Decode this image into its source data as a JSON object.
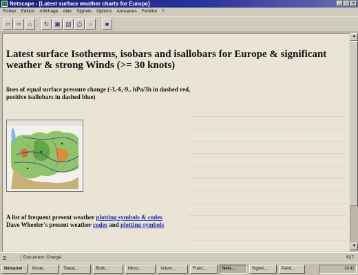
{
  "window": {
    "title": "Netscape - [Latest surface weather charts for Europe]"
  },
  "menu": {
    "items": [
      "Fichier",
      "Edition",
      "Affichage",
      "Aller",
      "Signets",
      "Options",
      "Annuaires",
      "Fenêtre",
      "?"
    ]
  },
  "toolbar": {
    "buttons": [
      {
        "icon": "back-arrow-icon"
      },
      {
        "icon": "forward-arrow-icon"
      },
      {
        "icon": "home-icon"
      },
      {
        "icon": "reload-icon"
      },
      {
        "icon": "images-icon"
      },
      {
        "icon": "open-icon"
      },
      {
        "icon": "print-icon"
      },
      {
        "icon": "find-icon"
      },
      {
        "icon": "stop-icon"
      }
    ]
  },
  "page": {
    "headline": "Latest surface Isotherms, isobars and isallobars for Europe & significant weather & strong Winds (>= 30 knots)",
    "subtitle_line1": "lines of equal surface pressure change (-3,-6,-9.. hPa/3h in dashed red,",
    "subtitle_line2": "positive isallobars in dashed blue)",
    "links_line1_prefix": "A list of frequent present weather ",
    "links_line1_link": "plotting symbols & codes",
    "links_line2_prefix": "Dave Wheeler's present weather ",
    "links_line2_link1": "codes",
    "links_line2_mid": " and ",
    "links_line2_link2": "plotting symbols"
  },
  "statusbar": {
    "text": "Document: Chargé",
    "right": "627"
  },
  "taskbar": {
    "start": "Démarrer",
    "tasks": [
      "Poste...",
      "Travai...",
      "Bioth...",
      "Micro...",
      "Volum...",
      "Franc...",
      "Nets...",
      "Signet...",
      "Paint..."
    ],
    "active_index": 6,
    "clock": "16:42"
  },
  "colors": {
    "titlebar": "#1a1f7a",
    "link": "#1f2aa8",
    "page_bg": "#e9e4d6"
  }
}
